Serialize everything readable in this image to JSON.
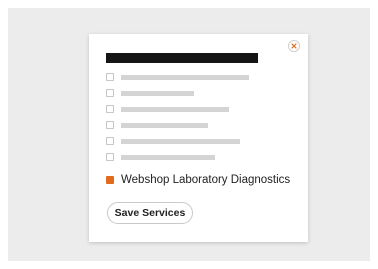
{
  "dialog": {
    "close_icon": "close-icon",
    "accent_color": "#e06b1c",
    "options": [
      {
        "checked": false
      },
      {
        "checked": false
      },
      {
        "checked": false
      },
      {
        "checked": false
      },
      {
        "checked": false
      },
      {
        "checked": false
      }
    ],
    "checked_option": {
      "label": "Webshop Laboratory Diagnostics",
      "checked": true
    },
    "save_label": "Save Services"
  }
}
